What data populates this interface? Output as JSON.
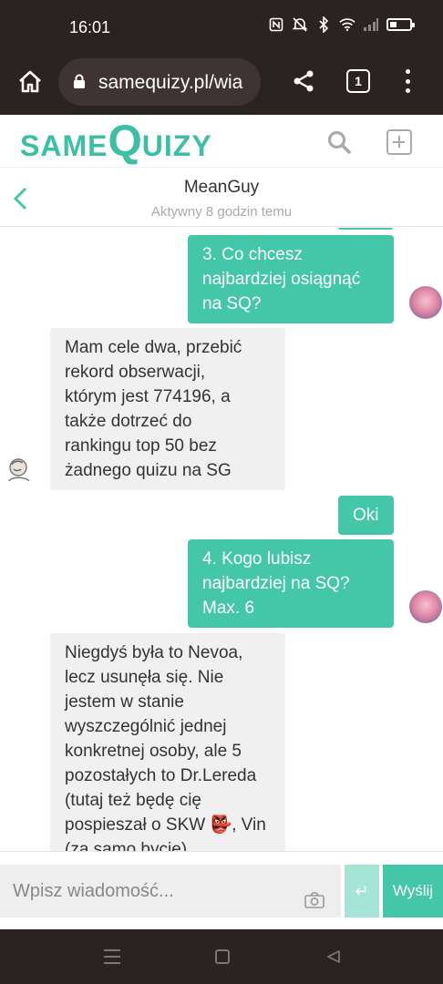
{
  "status_bar": {
    "time": "16:01",
    "icons": [
      "nfc-icon",
      "mute-icon",
      "bluetooth-icon",
      "wifi-icon",
      "signal-icon",
      "battery-icon"
    ]
  },
  "browser": {
    "url": "samequizy.pl/wia",
    "tab_count": "1"
  },
  "site": {
    "logo_same": "SAME",
    "logo_q": "Q",
    "logo_uizy": "UIZY",
    "brand_color": "#44c6a9"
  },
  "chat": {
    "name": "MeanGuy",
    "status": "Aktywny 8 godzin temu"
  },
  "messages": [
    {
      "side": "out",
      "lines": [
        "3. Co chcesz",
        "najbardziej osiągnąć",
        "na SQ?"
      ]
    },
    {
      "side": "in",
      "lines": [
        "Mam cele dwa, przebić",
        "rekord obserwacji,",
        "którym jest 774196, a",
        "także dotrzeć do",
        "rankingu top 50 bez",
        "żadnego quizu na SG"
      ]
    },
    {
      "side": "out",
      "lines": [
        "Oki"
      ]
    },
    {
      "side": "out",
      "lines": [
        "4. Kogo lubisz",
        "najbardziej na SQ?",
        "Max. 6"
      ]
    },
    {
      "side": "in",
      "lines": [
        "Niegdyś była to Nevoa,",
        "lecz usunęła się. Nie",
        "jestem w stanie",
        "wyszczególnić jednej",
        "konkretnej osoby, ale 5",
        "pozostałych to Dr.Lereda",
        "(tutaj też będę cię",
        "pospieszał o SKW 👺, Vin",
        "(za samo bycie),"
      ]
    }
  ],
  "composer": {
    "placeholder": "Wpisz wiadomość...",
    "enter_label": "↵",
    "send_label": "Wyślij"
  }
}
